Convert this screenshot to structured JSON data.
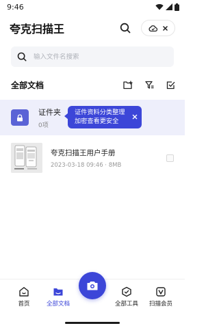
{
  "status_bar": {
    "time": "9:46"
  },
  "header": {
    "title": "夸克扫描王"
  },
  "search": {
    "placeholder": "输入文件名搜索"
  },
  "section": {
    "title": "全部文档"
  },
  "folder": {
    "name": "证件夹",
    "count": "0项"
  },
  "tooltip": {
    "line1": "证件资料分类整理",
    "line2": "加密查看更安全"
  },
  "documents": [
    {
      "name": "夸克扫描王用户手册",
      "meta": "2023-03-18 09:46 · 8MB"
    }
  ],
  "nav": {
    "items": [
      {
        "label": "首页"
      },
      {
        "label": "全部文档"
      },
      {
        "label": "全部工具"
      },
      {
        "label": "扫描会员"
      }
    ]
  },
  "colors": {
    "accent": "#3c46d8",
    "folder_bg": "#eeeffb",
    "search_bg": "#f4f5f8"
  }
}
